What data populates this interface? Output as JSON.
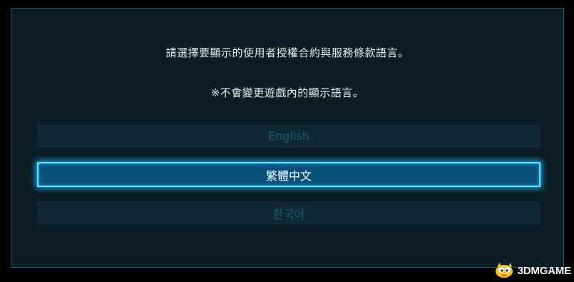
{
  "prompt": {
    "line1": "請選擇要顯示的使用者授權合約與服務條款語言。",
    "line2": "※不會變更遊戲內的顯示語言。"
  },
  "languages": [
    {
      "label": "English",
      "state": "inactive"
    },
    {
      "label": "繁體中文",
      "state": "selected"
    },
    {
      "label": "한국어",
      "state": "inactive"
    }
  ],
  "watermark": {
    "text": "3DMGAME",
    "icon": "3dm-mascot-logo"
  },
  "colors": {
    "panel_bg": "#0b1c24",
    "selected_bg": "#0a4f78",
    "selected_glow": "#6fe0ff",
    "inactive_text": "#1e5a72"
  }
}
